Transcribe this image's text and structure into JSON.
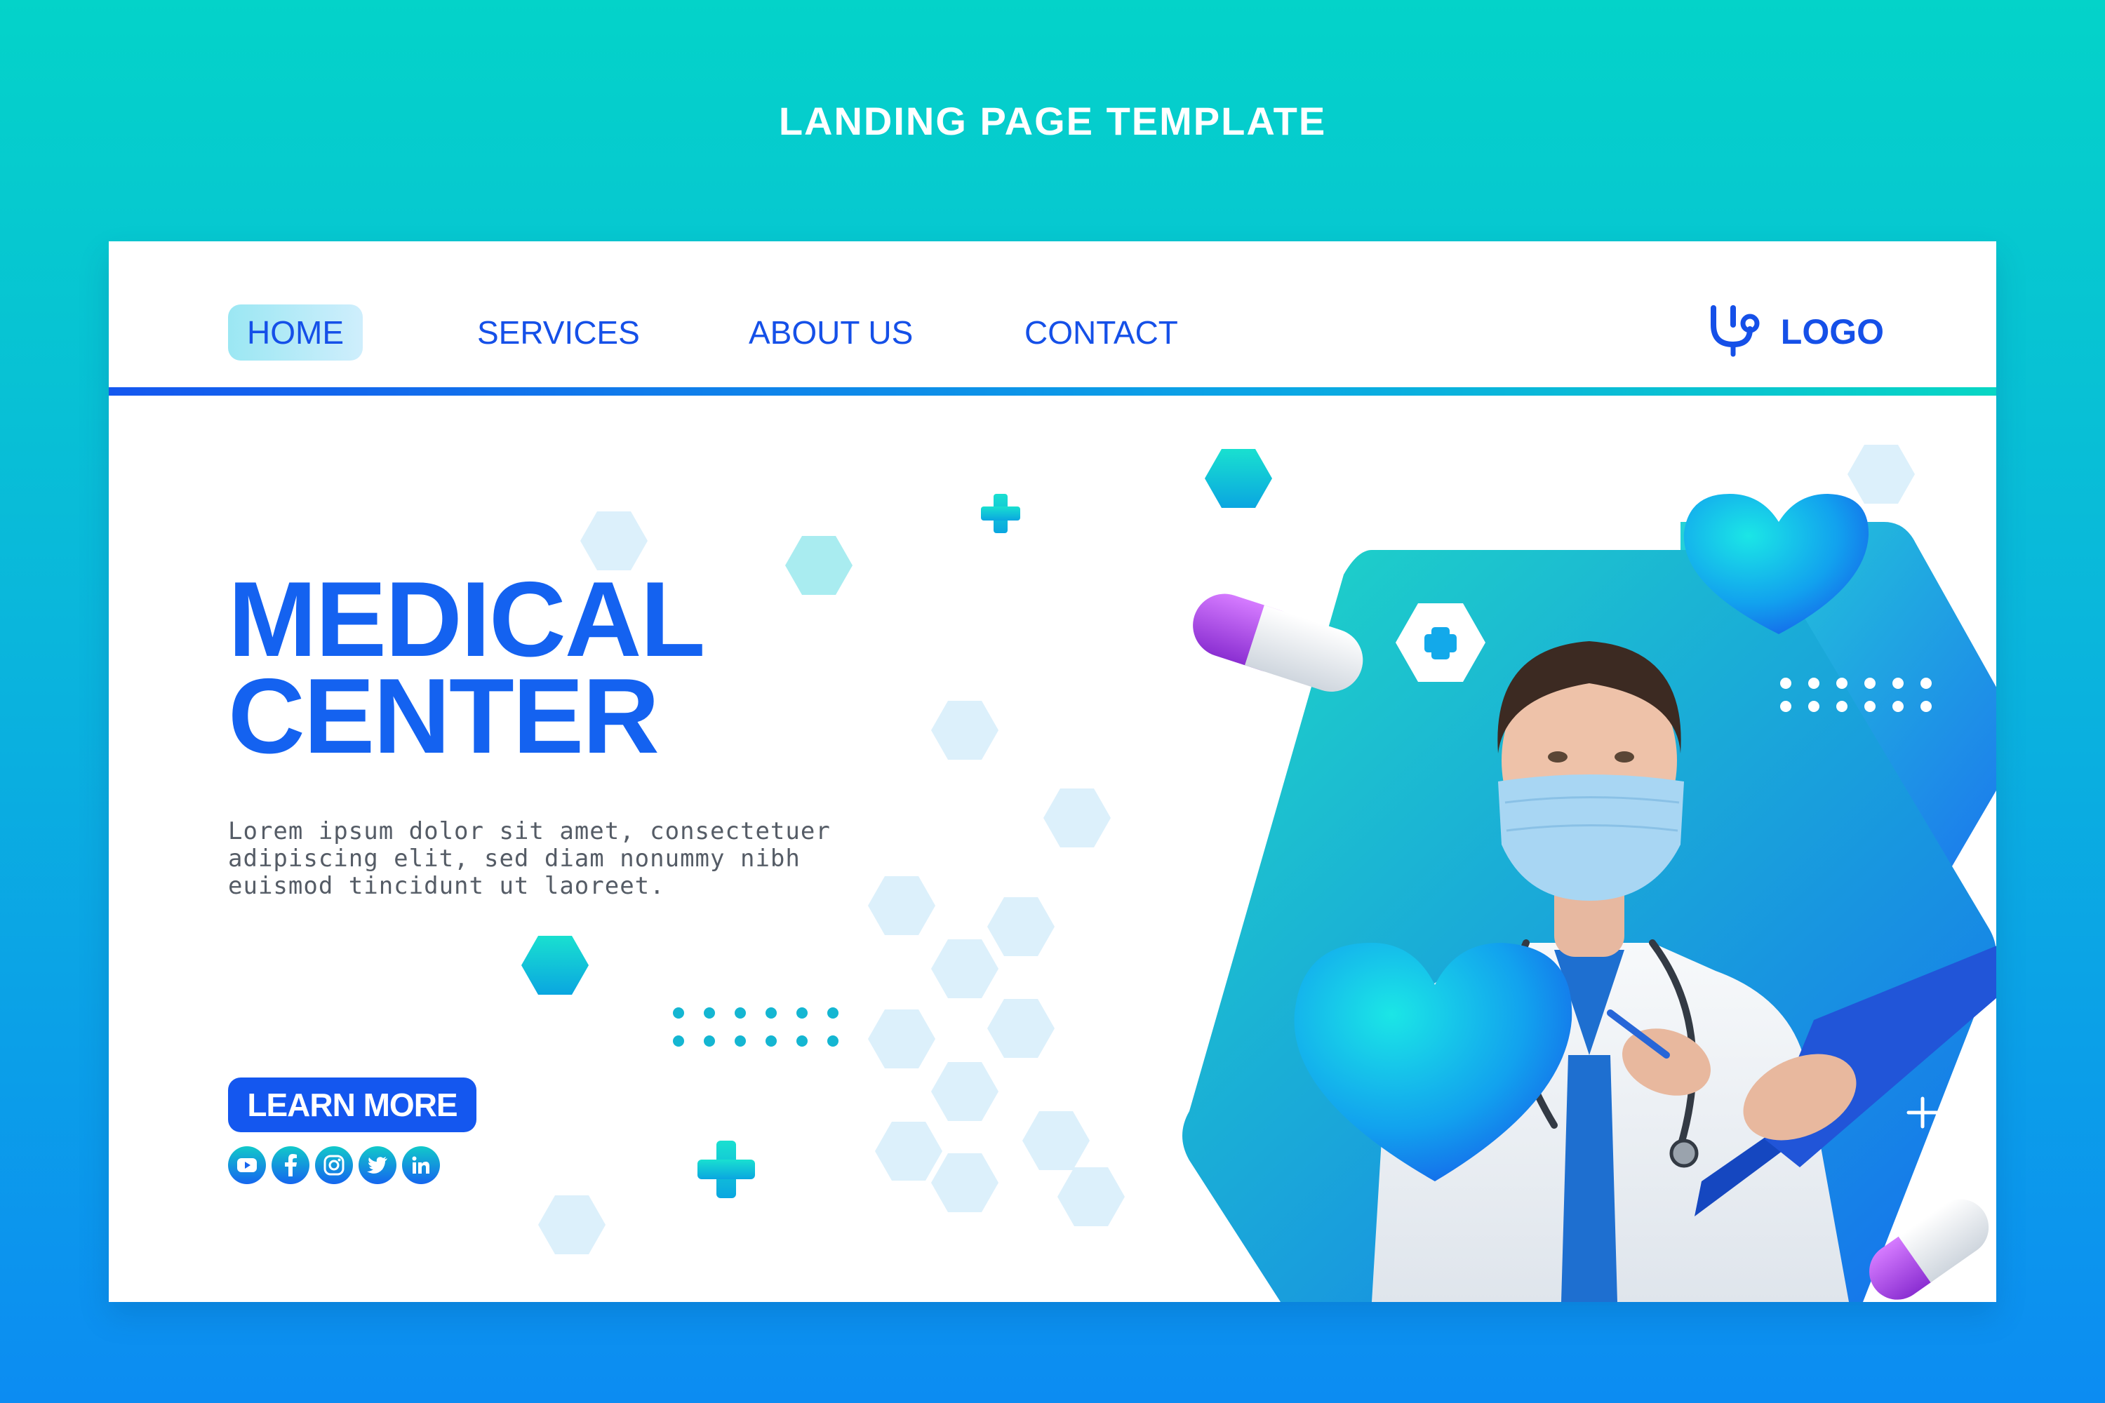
{
  "page_label": "LANDING PAGE TEMPLATE",
  "nav": {
    "items": [
      {
        "label": "HOME",
        "active": true
      },
      {
        "label": "SERVICES",
        "active": false
      },
      {
        "label": "ABOUT US",
        "active": false
      },
      {
        "label": "CONTACT",
        "active": false
      }
    ]
  },
  "logo": {
    "text": "LOGO",
    "icon": "stethoscope-icon"
  },
  "hero": {
    "title_lines": [
      "MEDICAL",
      "CENTER"
    ],
    "description_lines": [
      "Lorem ipsum dolor sit amet, consectetuer",
      "adipiscing elit, sed diam nonummy nibh",
      "euismod tincidunt ut laoreet."
    ],
    "cta_label": "LEARN MORE"
  },
  "socials": [
    "youtube-icon",
    "facebook-icon",
    "instagram-icon",
    "twitter-icon",
    "linkedin-icon"
  ],
  "colors": {
    "brand_blue": "#1462f0",
    "teal": "#08d6c4",
    "text_gray": "#555c66",
    "pill_purple": "#a23be0"
  }
}
